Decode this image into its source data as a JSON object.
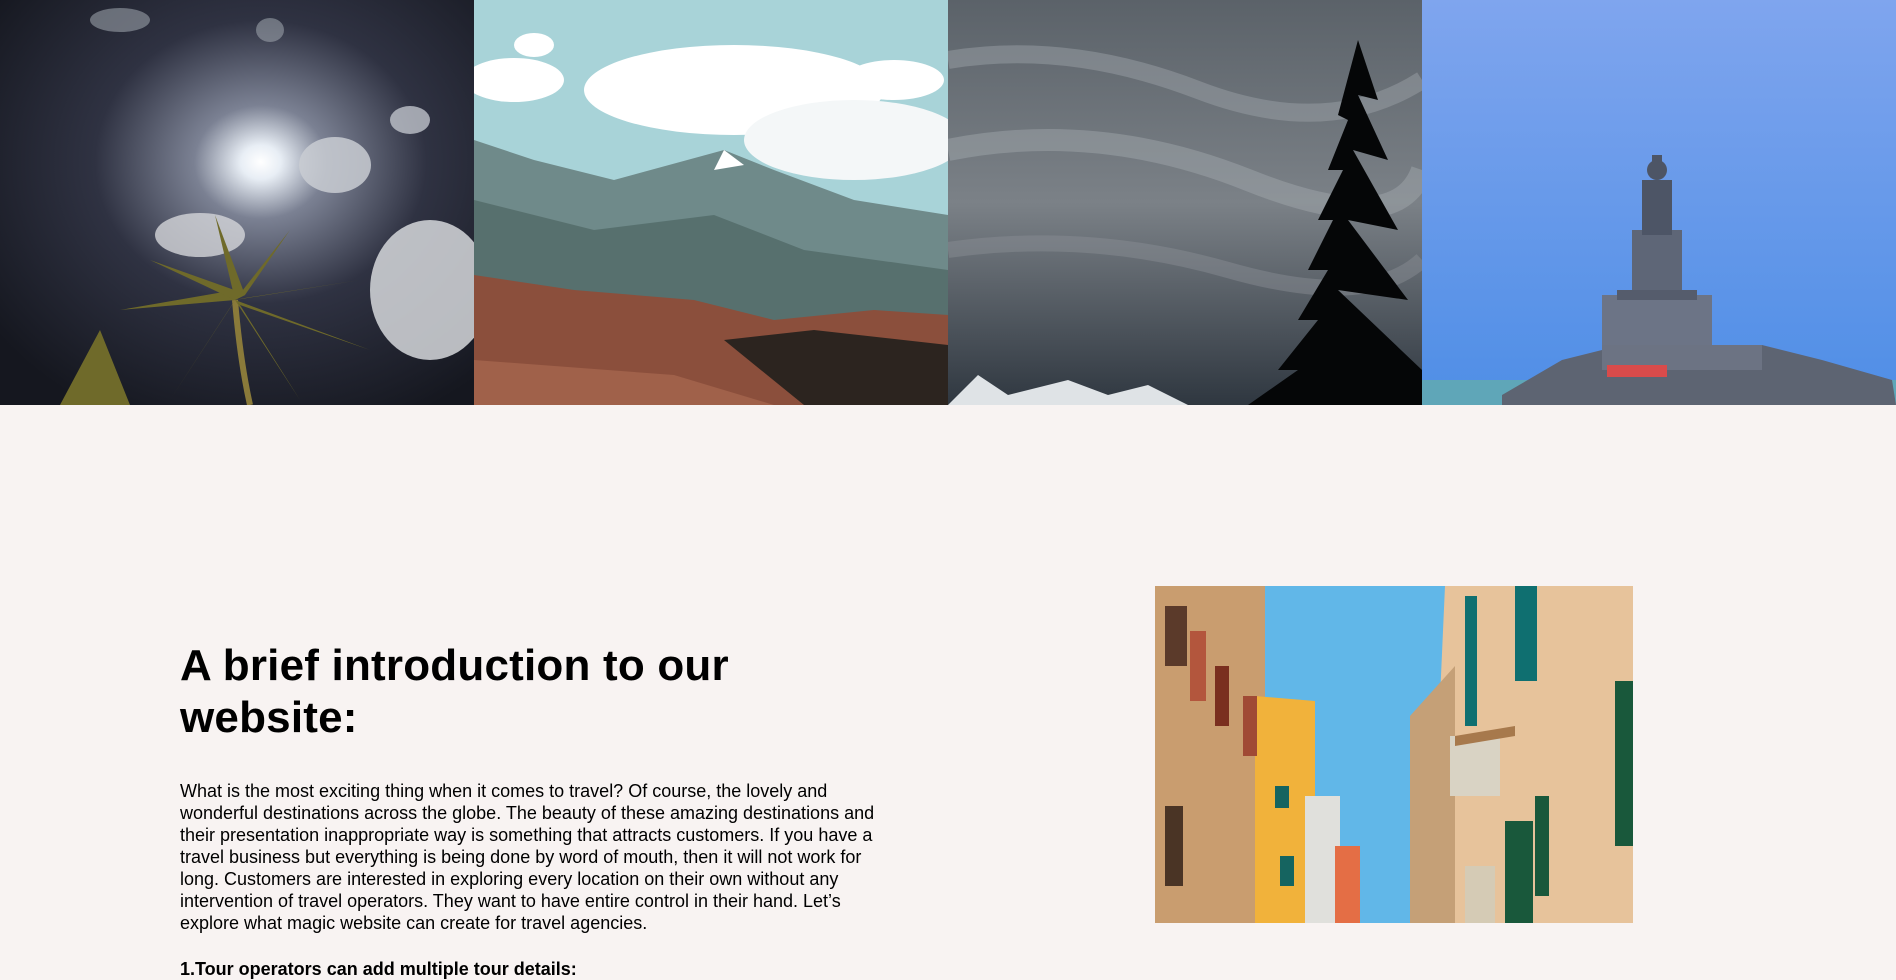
{
  "gallery": {
    "images": [
      {
        "alt": "Palm tree under the sun and clouds"
      },
      {
        "alt": "Mountain range with clouds"
      },
      {
        "alt": "Dark cloudy sky with pine tree silhouette"
      },
      {
        "alt": "Statue on a rocky island by the sea"
      }
    ]
  },
  "intro": {
    "heading": "A brief introduction to our website:",
    "paragraph": "What is the most exciting thing when it comes to travel? Of course, the lovely and wonderful destinations across the globe. The beauty of these amazing destinations and their presentation inappropriate way is something that attracts customers. If you have a travel business but everything is being done by word of mouth, then it will not work for long. Customers are interested in exploring every location on their own without any intervention of travel operators. They want to have entire control in their hand. Let’s explore what magic website can create for travel agencies.",
    "subheading": "1.Tour operators can add multiple tour details:"
  },
  "side_photo": {
    "alt": "Narrow street between colorful buildings"
  },
  "colors": {
    "page_background": "#f8f3f2",
    "text": "#000000"
  }
}
